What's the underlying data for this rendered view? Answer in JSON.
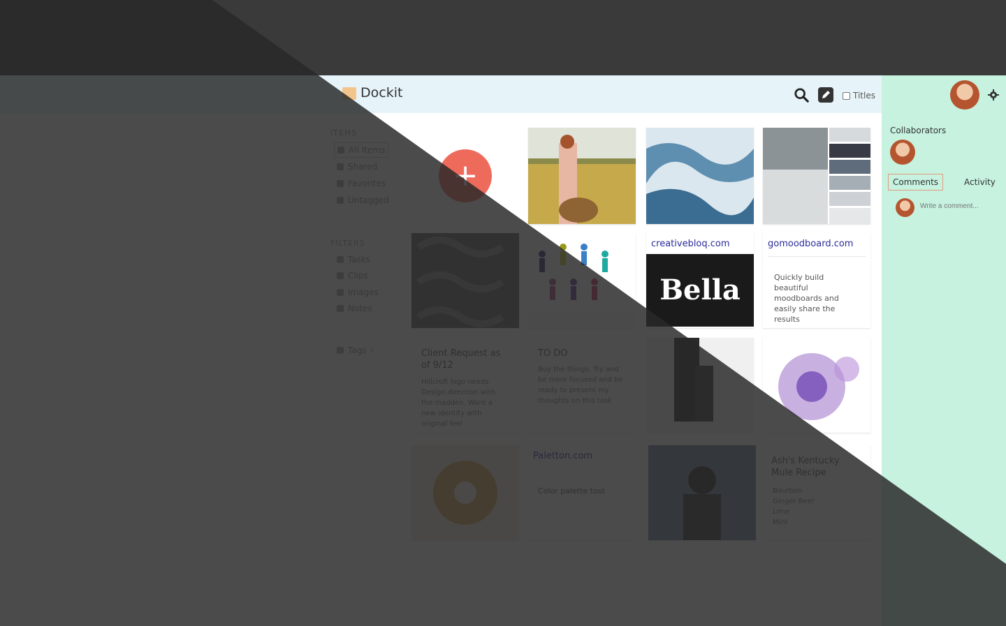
{
  "header": {
    "app_title": "Dockit",
    "titles_label": "Titles"
  },
  "sidebar": {
    "items_title": "ITEMS",
    "items": [
      {
        "label": "All Items"
      },
      {
        "label": "Shared"
      },
      {
        "label": "Favorites"
      },
      {
        "label": "Untagged"
      }
    ],
    "filters_title": "FILTERS",
    "filters": [
      {
        "label": "Tasks"
      },
      {
        "label": "Clips"
      },
      {
        "label": "Images"
      },
      {
        "label": "Notes"
      }
    ],
    "tags_label": "Tags"
  },
  "board": {
    "add_symbol": "+",
    "creativebloq": {
      "link": "creativebloq.com",
      "brand": "Bella"
    },
    "gomoodboard": {
      "link": "gomoodboard.com",
      "description": "Quickly build beautiful moodboards and easily share the results"
    },
    "client_note": {
      "title": "Client Request as of 9/12",
      "body": "Hillcroft logo needs Design direction with the madden. Want a new identity with original feel"
    },
    "todo_note": {
      "title": "TO DO",
      "body": "Buy the things. Try and be more focused and be ready to present my thoughts on this task"
    },
    "paletton": {
      "link": "Paletton.com",
      "desc": "Color palette tool"
    },
    "recipe_note": {
      "title": "Ash's Kentucky Mule Recipe",
      "body": [
        "Bourbon",
        "Ginger Beer",
        "Lime",
        "Mint"
      ]
    }
  },
  "right_panel": {
    "collaborators_title": "Collaborators",
    "tabs": [
      {
        "label": "Comments"
      },
      {
        "label": "Activity"
      }
    ],
    "comment_placeholder": "Write a comment..."
  },
  "colors": {
    "header_bg": "#e6f4fa",
    "panel_bg": "#c6f2df",
    "add_button": "#ee6b5c",
    "overlay": "#2b2b2b",
    "link": "#2a2a9a"
  }
}
